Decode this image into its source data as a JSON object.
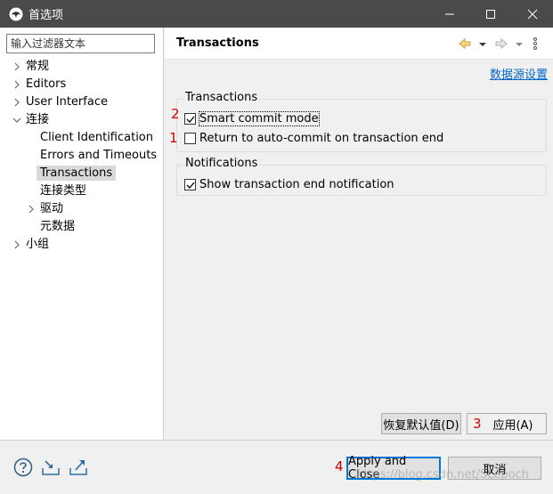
{
  "window": {
    "title": "首选项"
  },
  "filter": {
    "placeholder": "输入过滤器文本"
  },
  "tree": {
    "items": [
      {
        "label": "常规"
      },
      {
        "label": "Editors"
      },
      {
        "label": "User Interface"
      },
      {
        "label": "连接"
      },
      {
        "label": "Client Identification"
      },
      {
        "label": "Errors and Timeouts"
      },
      {
        "label": "Transactions"
      },
      {
        "label": "连接类型"
      },
      {
        "label": "驱动"
      },
      {
        "label": "元数据"
      },
      {
        "label": "小组"
      }
    ]
  },
  "page": {
    "title": "Transactions",
    "link": "数据源设置",
    "groups": {
      "transactions": {
        "title": "Transactions",
        "smart_commit": {
          "label": "Smart commit mode",
          "checked": true
        },
        "auto_commit": {
          "label": "Return to auto-commit on transaction end",
          "checked": false
        }
      },
      "notifications": {
        "title": "Notifications",
        "show_notification": {
          "label": "Show transaction end notification",
          "checked": true
        }
      }
    },
    "restore_defaults": "恢复默认值(D)",
    "apply": "应用(A)"
  },
  "footer": {
    "apply_close": "Apply and Close",
    "cancel": "取消",
    "watermark": "https://blog.csdn.net/SLepoch"
  },
  "annotations": {
    "n1": "1",
    "n2": "2",
    "n3": "3",
    "n4": "4"
  }
}
